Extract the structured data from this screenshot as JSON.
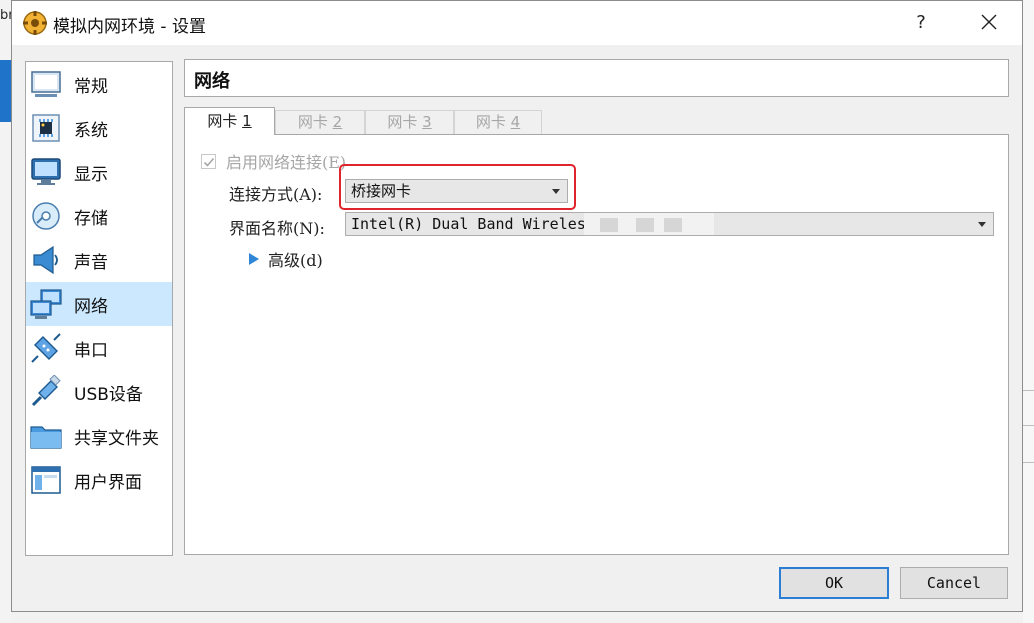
{
  "background": {
    "left_text": "br"
  },
  "window": {
    "title": "模拟内网环境 - 设置",
    "help_glyph": "?"
  },
  "sidebar": {
    "items": [
      {
        "label": "常规",
        "icon": "general-icon"
      },
      {
        "label": "系统",
        "icon": "system-chip-icon"
      },
      {
        "label": "显示",
        "icon": "display-monitor-icon"
      },
      {
        "label": "存储",
        "icon": "storage-disk-icon"
      },
      {
        "label": "声音",
        "icon": "audio-speaker-icon"
      },
      {
        "label": "网络",
        "icon": "network-icon",
        "selected": true
      },
      {
        "label": "串口",
        "icon": "serial-port-icon"
      },
      {
        "label": "USB设备",
        "icon": "usb-icon"
      },
      {
        "label": "共享文件夹",
        "icon": "shared-folder-icon"
      },
      {
        "label": "用户界面",
        "icon": "user-interface-icon"
      }
    ]
  },
  "page": {
    "title": "网络"
  },
  "tabs": [
    {
      "prefix": "网卡 ",
      "num": "1",
      "active": true
    },
    {
      "prefix": "网卡 ",
      "num": "2",
      "active": false
    },
    {
      "prefix": "网卡 ",
      "num": "3",
      "active": false
    },
    {
      "prefix": "网卡 ",
      "num": "4",
      "active": false
    }
  ],
  "adapter": {
    "enable_label": "启用网络连接(E)",
    "enabled": true,
    "attach_label": "连接方式(A):",
    "attach_value": "桥接网卡",
    "name_label": "界面名称(N):",
    "name_value": "Intel(R) Dual Band Wireles",
    "advanced_label": "高级(d)"
  },
  "buttons": {
    "ok": "OK",
    "cancel": "Cancel"
  },
  "colors": {
    "selection": "#cce8ff",
    "highlight_box": "#e0242b",
    "ok_border": "#2a7fd4",
    "advanced_arrow": "#2f86d6"
  }
}
